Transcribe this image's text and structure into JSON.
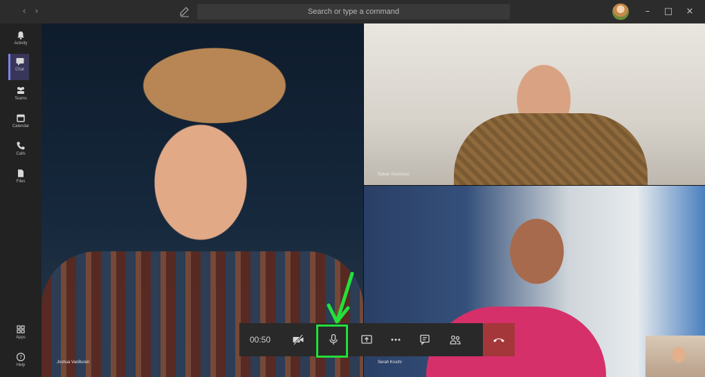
{
  "titlebar": {
    "search_placeholder": "Search or type a command"
  },
  "rail": {
    "items": [
      {
        "label": "Activity",
        "icon": "bell-icon"
      },
      {
        "label": "Chat",
        "icon": "chat-icon"
      },
      {
        "label": "Teams",
        "icon": "teams-icon"
      },
      {
        "label": "Calendar",
        "icon": "calendar-icon"
      },
      {
        "label": "Calls",
        "icon": "phone-icon"
      },
      {
        "label": "Files",
        "icon": "file-icon"
      },
      {
        "label": "Apps",
        "icon": "apps-icon"
      },
      {
        "label": "Help",
        "icon": "help-icon"
      }
    ]
  },
  "stage": {
    "participants": [
      {
        "name": "Joshua VanBuren"
      },
      {
        "name": "Babak Shammas"
      },
      {
        "name": "Serah Kruchi"
      }
    ]
  },
  "controls": {
    "timer": "00:50"
  },
  "colors": {
    "accent": "#7b83eb",
    "hangup": "#a4373a",
    "highlight": "#22e03a"
  }
}
